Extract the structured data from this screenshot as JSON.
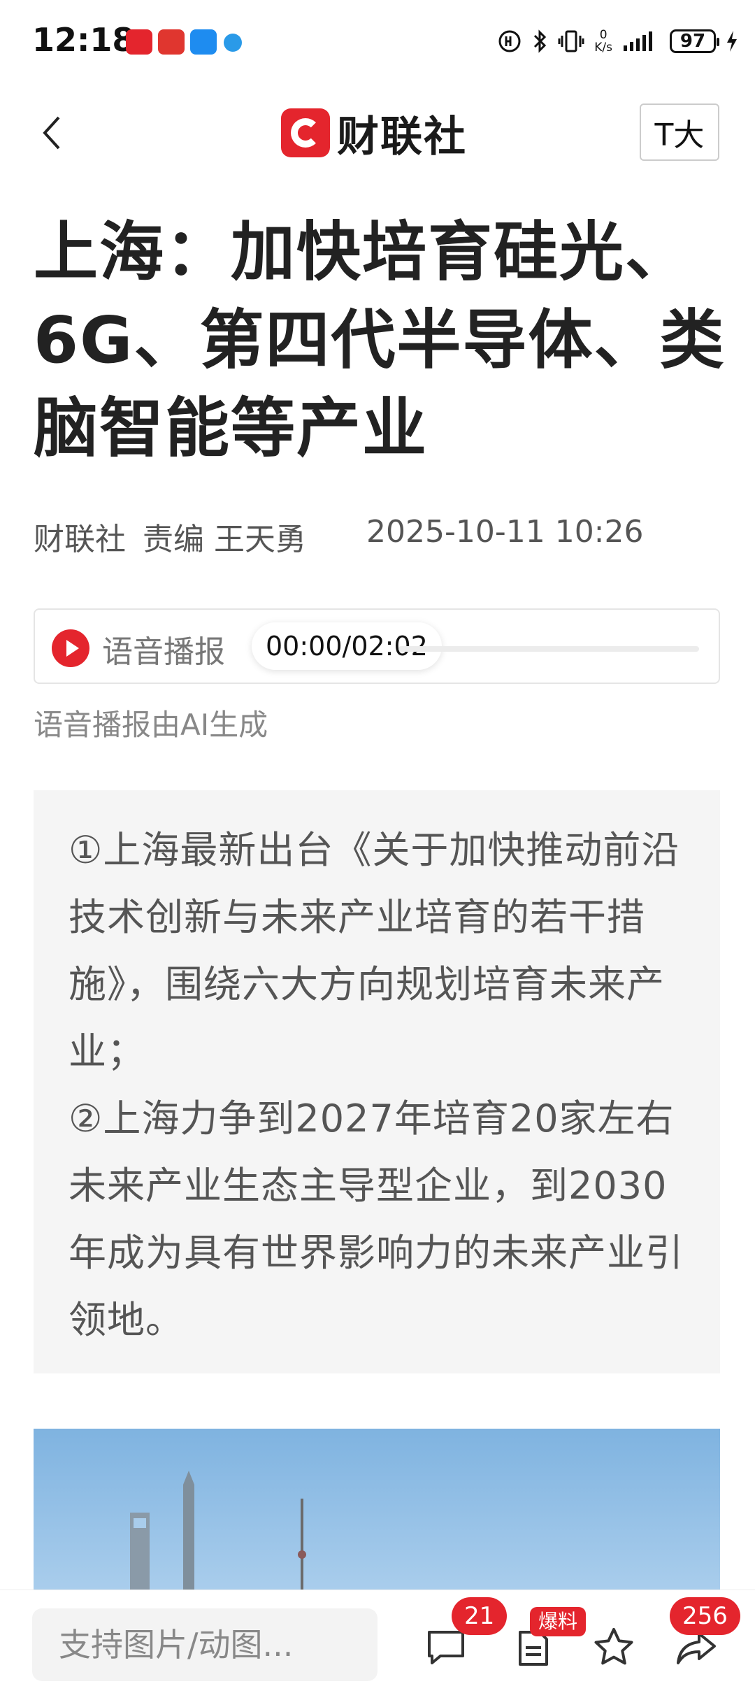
{
  "status_bar": {
    "time": "12:18",
    "network_speed_value": "0",
    "network_speed_unit": "K/s",
    "battery": "97"
  },
  "header": {
    "logo_text": "财联社",
    "font_size_button": "T大"
  },
  "article": {
    "title": "上海：加快培育硅光、6G、第四代半导体、类脑智能等产业",
    "source": "财联社",
    "editor": "责编 王天勇",
    "datetime": "2025-10-11 10:26"
  },
  "audio": {
    "label": "语音播报",
    "time": "00:00/02:02",
    "progress": 0,
    "note": "语音播报由AI生成"
  },
  "summary": {
    "text": "①上海最新出台《关于加快推动前沿技术创新与未来产业培育的若干措施》，围绕六大方向规划培育未来产业；\n②上海力争到2027年培育20家左右未来产业生态主导型企业，到2030年成为具有世界影响力的未来产业引领地。"
  },
  "bottom_bar": {
    "comment_placeholder": "支持图片/动图...",
    "comment_count": "21",
    "report_badge": "爆料",
    "share_count": "256"
  },
  "colors": {
    "brand_red": "#e4252d",
    "summary_bg": "#f5f5f5"
  }
}
